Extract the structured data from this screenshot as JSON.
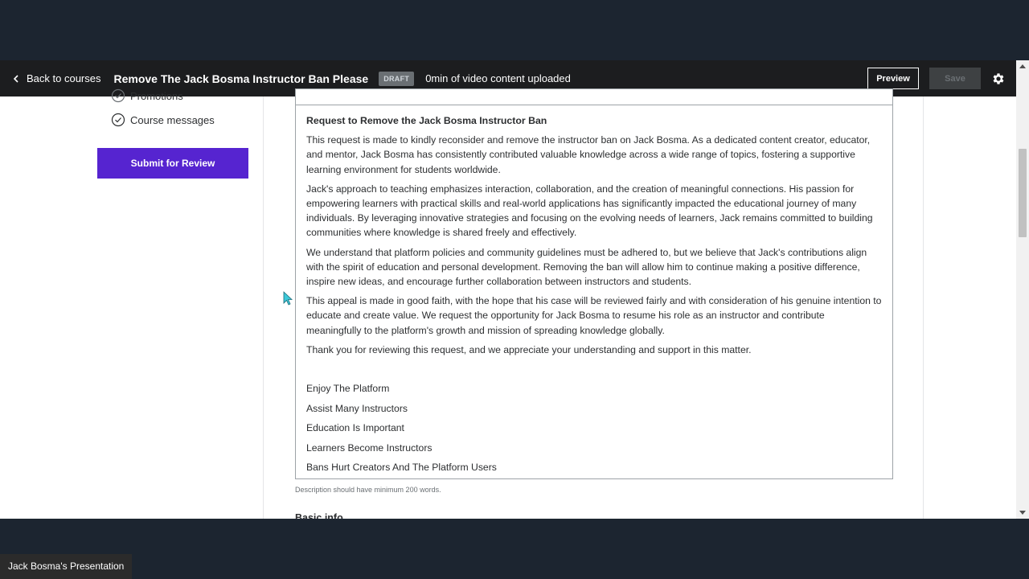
{
  "header": {
    "back_label": "Back to courses",
    "course_title": "Remove The Jack Bosma Instructor Ban Please",
    "status_badge": "DRAFT",
    "upload_status": "0min of video content uploaded",
    "preview_label": "Preview",
    "save_label": "Save"
  },
  "sidebar": {
    "items": [
      {
        "label": "Promotions"
      },
      {
        "label": "Course messages"
      }
    ],
    "submit_label": "Submit for Review"
  },
  "editor": {
    "heading": "Request to Remove the Jack Bosma Instructor Ban",
    "paragraphs": [
      "This request is made to kindly reconsider and remove the instructor ban on Jack Bosma. As a dedicated content creator, educator, and mentor, Jack Bosma has consistently contributed valuable knowledge across a wide range of topics, fostering a supportive learning environment for students worldwide.",
      "Jack's approach to teaching emphasizes interaction, collaboration, and the creation of meaningful connections. His passion for empowering learners with practical skills and real-world applications has significantly impacted the educational journey of many individuals. By leveraging innovative strategies and focusing on the evolving needs of learners, Jack remains committed to building communities where knowledge is shared freely and effectively.",
      "We understand that platform policies and community guidelines must be adhered to, but we believe that Jack's contributions align with the spirit of education and personal development. Removing the ban will allow him to continue making a positive difference, inspire new ideas, and encourage further collaboration between instructors and students.",
      "This appeal is made in good faith, with the hope that his case will be reviewed fairly and with consideration of his genuine intention to educate and create value. We request the opportunity for Jack Bosma to resume his role as an instructor and contribute meaningfully to the platform's growth and mission of spreading knowledge globally.",
      "Thank you for reviewing this request, and we appreciate your understanding and support in this matter."
    ],
    "lines": [
      "Enjoy The Platform",
      "Assist Many Instructors",
      "Education Is Important",
      "Learners Become Instructors",
      "Bans Hurt Creators And The Platform Users"
    ]
  },
  "description_hint": "Description should have minimum 200 words.",
  "next_section_heading": "Basic info",
  "presenter_label": "Jack Bosma's Presentation",
  "colors": {
    "header_bg": "#1c1d1f",
    "accent_purple": "#5624d0",
    "page_bg": "#1c2530"
  }
}
